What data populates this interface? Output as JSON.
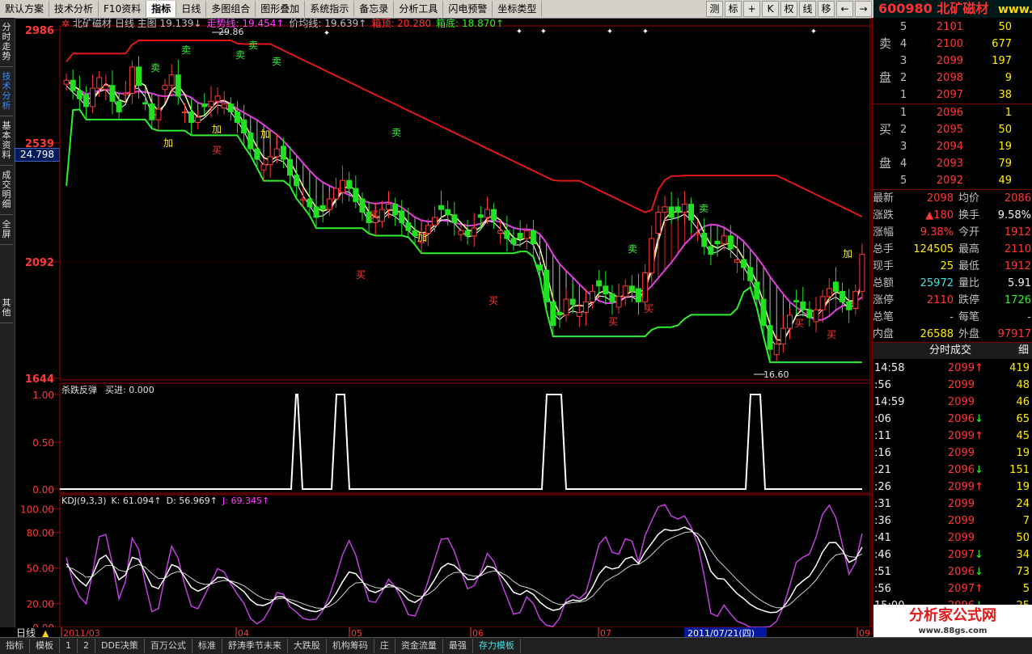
{
  "toolbar": {
    "items": [
      "默认方案",
      "技术分析",
      "F10资料",
      "指标",
      "日线",
      "多图组合",
      "图形叠加",
      "系统指示",
      "备忘录",
      "分析工具",
      "闪电预警",
      "坐标类型"
    ],
    "active_index": 3,
    "right_buttons": [
      "测",
      "标",
      "+",
      "K",
      "权",
      "线",
      "移",
      "←",
      "→"
    ]
  },
  "brand": {
    "code": "600980",
    "name": "北矿磁材",
    "site": "www.fxj"
  },
  "sidetabs": [
    "分时走势",
    "技术分析",
    "基本资料",
    "成交明细",
    "全屏",
    "其他"
  ],
  "value_label": "24.798",
  "main_chart": {
    "header": [
      {
        "text": "北矿磁材 日线 主图 19.139↓",
        "color": "#c0c0c0"
      },
      {
        "text": "走势线: 19.454↑",
        "color": "#ff40ff"
      },
      {
        "text": "价均线: 19.639↑",
        "color": "#c0c0c0"
      },
      {
        "text": "箱顶: 20.280",
        "color": "#ff3838"
      },
      {
        "text": "箱底: 18.870↑",
        "color": "#2ef02e"
      }
    ],
    "price_ticks": [
      "2986",
      "2539",
      "2092",
      "1644"
    ],
    "annotations": {
      "high": "29.86",
      "low": "16.60"
    },
    "signals": [
      {
        "t": "卖",
        "c": "#2ef02e"
      },
      {
        "t": "卖",
        "c": "#2ef02e"
      },
      {
        "t": "卖",
        "c": "#2ef02e"
      },
      {
        "t": "卖",
        "c": "#2ef02e"
      },
      {
        "t": "卖",
        "c": "#2ef02e"
      },
      {
        "t": "卖",
        "c": "#2ef02e"
      },
      {
        "t": "卖",
        "c": "#2ef02e"
      },
      {
        "t": "卖",
        "c": "#2ef02e"
      },
      {
        "t": "加",
        "c": "#ffee00"
      },
      {
        "t": "加",
        "c": "#ffee00"
      },
      {
        "t": "加",
        "c": "#ffee00"
      },
      {
        "t": "加",
        "c": "#ffee00"
      },
      {
        "t": "加",
        "c": "#ffee00"
      },
      {
        "t": "买",
        "c": "#ff3838"
      },
      {
        "t": "买",
        "c": "#ff3838"
      },
      {
        "t": "买",
        "c": "#ff3838"
      },
      {
        "t": "买",
        "c": "#ff3838"
      },
      {
        "t": "买",
        "c": "#ff3838"
      },
      {
        "t": "买",
        "c": "#ff3838"
      },
      {
        "t": "买",
        "c": "#ff3838"
      },
      {
        "t": "买",
        "c": "#ff3838"
      }
    ]
  },
  "panel2": {
    "title": "杀跌反弹",
    "value": "买进: 0.000",
    "ticks": [
      "1.00",
      "0.50",
      "0.00"
    ]
  },
  "panel3": {
    "title": "KDJ(9,3,3)",
    "k": "K: 61.094↑",
    "d": "D: 56.969↑",
    "j": "J: 69.345↑",
    "ticks": [
      "100.00",
      "80.00",
      "50.00",
      "20.00",
      "0.00"
    ]
  },
  "xaxis": {
    "labels": [
      "2011/03",
      "04",
      "05",
      "06",
      "07",
      "09"
    ],
    "cursor": "2011/07/21(四)",
    "period": "日线"
  },
  "chart_data": {
    "type": "candlestick",
    "title": "北矿磁材 日线",
    "ylim": [
      16.44,
      29.86
    ],
    "high": 29.86,
    "low": 16.6,
    "close_approx": [
      27.8,
      27.4,
      27.1,
      26.8,
      27.5,
      27.9,
      27.6,
      27.0,
      26.6,
      27.3,
      28.3,
      27.6,
      26.9,
      26.3,
      26.7,
      27.6,
      28.0,
      27.2,
      26.6,
      26.2,
      26.4,
      26.8,
      27.0,
      27.2,
      26.9,
      26.6,
      26.2,
      25.8,
      25.2,
      24.8,
      24.6,
      24.9,
      25.2,
      24.8,
      24.2,
      23.8,
      23.3,
      23.0,
      22.6,
      22.9,
      23.3,
      23.7,
      24.0,
      23.7,
      23.2,
      22.8,
      22.4,
      22.6,
      22.9,
      23.1,
      22.7,
      22.4,
      22.1,
      21.9,
      22.0,
      22.3,
      22.6,
      22.9,
      22.7,
      22.4,
      22.1,
      21.9,
      22.2,
      22.6,
      22.9,
      22.5,
      22.1,
      21.8,
      21.6,
      21.8,
      22.1,
      21.6,
      20.6,
      19.4,
      18.5,
      18.9,
      19.5,
      19.3,
      19.0,
      19.4,
      19.8,
      20.0,
      19.7,
      19.4,
      19.6,
      20.0,
      19.8,
      19.4,
      20.5,
      21.8,
      22.8,
      23.0,
      22.6,
      22.8,
      23.1,
      22.5,
      22.0,
      21.5,
      21.2,
      21.6,
      21.9,
      21.4,
      21.0,
      20.7,
      20.2,
      19.5,
      18.5,
      17.6,
      17.8,
      18.4,
      18.9,
      19.4,
      19.1,
      18.8,
      19.1,
      19.6,
      19.9,
      19.8,
      19.4,
      19.1,
      19.8,
      21.2
    ],
    "kdj": {
      "K": 61.094,
      "D": 56.969,
      "J": 69.345
    },
    "signal_last": 0.0
  },
  "tape": {
    "sell": [
      {
        "lbl": "5",
        "p": "2101",
        "v": "50"
      },
      {
        "lbl": "4",
        "p": "2100",
        "v": "677"
      },
      {
        "lbl": "3",
        "p": "2099",
        "v": "197"
      },
      {
        "lbl": "2",
        "p": "2098",
        "v": "9"
      },
      {
        "lbl": "1",
        "p": "2097",
        "v": "38"
      }
    ],
    "buy": [
      {
        "lbl": "1",
        "p": "2096",
        "v": "1"
      },
      {
        "lbl": "2",
        "p": "2095",
        "v": "50"
      },
      {
        "lbl": "3",
        "p": "2094",
        "v": "19"
      },
      {
        "lbl": "4",
        "p": "2093",
        "v": "79"
      },
      {
        "lbl": "5",
        "p": "2092",
        "v": "49"
      }
    ],
    "sell_label": [
      "卖",
      "盘"
    ],
    "buy_label": [
      "买",
      "盘"
    ],
    "stats": [
      {
        "l1": "最新",
        "v1": "2098",
        "l2": "均价",
        "v2": "2086"
      },
      {
        "l1": "涨跌",
        "v1": "▲180",
        "l2": "换手",
        "v2": "9.58%"
      },
      {
        "l1": "涨幅",
        "v1": "9.38%",
        "l2": "今开",
        "v2": "1912"
      },
      {
        "l1": "总手",
        "v1": "124505",
        "l2": "最高",
        "v2": "2110"
      },
      {
        "l1": "现手",
        "v1": "25",
        "l2": "最低",
        "v2": "1912"
      },
      {
        "l1": "总额",
        "v1": "25972",
        "l2": "量比",
        "v2": "5.91"
      },
      {
        "l1": "涨停",
        "v1": "2110",
        "l2": "跌停",
        "v2": "1726"
      },
      {
        "l1": "总笔",
        "v1": "-",
        "l2": "每笔",
        "v2": "-"
      },
      {
        "l1": "内盘",
        "v1": "26588",
        "l2": "外盘",
        "v2": "97917"
      }
    ],
    "ticks_title": "分时成交",
    "ticks_tab": "细",
    "ticks": [
      {
        "t": "14:58",
        "p": "2099",
        "a": "↑",
        "v": "419"
      },
      {
        "t": ":56",
        "p": "2099",
        "a": "",
        "v": "48"
      },
      {
        "t": "14:59",
        "p": "2099",
        "a": "",
        "v": "46"
      },
      {
        "t": ":06",
        "p": "2096",
        "a": "↓",
        "v": "65"
      },
      {
        "t": ":11",
        "p": "2099",
        "a": "↑",
        "v": "45"
      },
      {
        "t": ":16",
        "p": "2099",
        "a": "",
        "v": "19"
      },
      {
        "t": ":21",
        "p": "2096",
        "a": "↓",
        "v": "151"
      },
      {
        "t": ":26",
        "p": "2099",
        "a": "↑",
        "v": "19"
      },
      {
        "t": ":31",
        "p": "2099",
        "a": "",
        "v": "24"
      },
      {
        "t": ":36",
        "p": "2099",
        "a": "",
        "v": "7"
      },
      {
        "t": ":41",
        "p": "2099",
        "a": "",
        "v": "50"
      },
      {
        "t": ":46",
        "p": "2097",
        "a": "↓",
        "v": "34"
      },
      {
        "t": ":51",
        "p": "2096",
        "a": "↓",
        "v": "73"
      },
      {
        "t": ":56",
        "p": "2097",
        "a": "↑",
        "v": "5"
      },
      {
        "t": "15:00",
        "p": "2096",
        "a": "↓",
        "v": "25"
      }
    ]
  },
  "bottombar": [
    "指标",
    "模板",
    "1",
    "2",
    "DDE决策",
    "百万公式",
    "标准",
    "舒涛季节未来",
    "大跌股",
    "机构筹码",
    "庄",
    "资金流量",
    "最强",
    "存力模板"
  ],
  "bottombar_active": 13,
  "watermark": {
    "title": "分析家公式网",
    "url": "www.88gs.com"
  }
}
